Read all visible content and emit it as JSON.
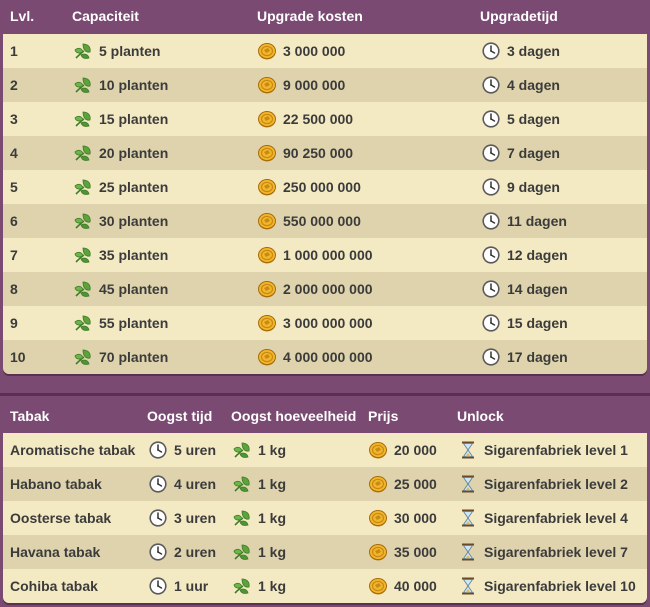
{
  "upgrade_table": {
    "headers": {
      "level": "Lvl.",
      "capacity": "Capaciteit",
      "cost": "Upgrade kosten",
      "time": "Upgradetijd"
    },
    "rows": [
      {
        "level": "1",
        "capacity": "5 planten",
        "cost": "3 000 000",
        "time": "3 dagen"
      },
      {
        "level": "2",
        "capacity": "10 planten",
        "cost": "9 000 000",
        "time": "4 dagen"
      },
      {
        "level": "3",
        "capacity": "15 planten",
        "cost": "22 500 000",
        "time": "5 dagen"
      },
      {
        "level": "4",
        "capacity": "20 planten",
        "cost": "90 250 000",
        "time": "7 dagen"
      },
      {
        "level": "5",
        "capacity": "25 planten",
        "cost": "250 000 000",
        "time": "9 dagen"
      },
      {
        "level": "6",
        "capacity": "30 planten",
        "cost": "550 000 000",
        "time": "11 dagen"
      },
      {
        "level": "7",
        "capacity": "35 planten",
        "cost": "1 000 000 000",
        "time": "12 dagen"
      },
      {
        "level": "8",
        "capacity": "45 planten",
        "cost": "2 000 000 000",
        "time": "14 dagen"
      },
      {
        "level": "9",
        "capacity": "55 planten",
        "cost": "3 000 000 000",
        "time": "15 dagen"
      },
      {
        "level": "10",
        "capacity": "70 planten",
        "cost": "4 000 000 000",
        "time": "17 dagen"
      }
    ]
  },
  "tobacco_table": {
    "headers": {
      "name": "Tabak",
      "harvest_time": "Oogst tijd",
      "harvest_amount": "Oogst hoeveelheid",
      "price": "Prijs",
      "unlock": "Unlock"
    },
    "rows": [
      {
        "name": "Aromatische tabak",
        "harvest_time": "5 uren",
        "harvest_amount": "1 kg",
        "price": "20 000",
        "unlock": "Sigarenfabriek level 1"
      },
      {
        "name": "Habano tabak",
        "harvest_time": "4 uren",
        "harvest_amount": "1 kg",
        "price": "25 000",
        "unlock": "Sigarenfabriek level 2"
      },
      {
        "name": "Oosterse tabak",
        "harvest_time": "3 uren",
        "harvest_amount": "1 kg",
        "price": "30 000",
        "unlock": "Sigarenfabriek level 4"
      },
      {
        "name": "Havana tabak",
        "harvest_time": "2 uren",
        "harvest_amount": "1 kg",
        "price": "35 000",
        "unlock": "Sigarenfabriek level 7"
      },
      {
        "name": "Cohiba tabak",
        "harvest_time": "1 uur",
        "harvest_amount": "1 kg",
        "price": "40 000",
        "unlock": "Sigarenfabriek level 10"
      }
    ]
  },
  "icons": {
    "capacity": "leaf-icon",
    "cost": "coin-icon",
    "time": "clock-icon",
    "unlock": "hourglass-icon"
  },
  "colors": {
    "header_bg": "#7b4a73",
    "row_light": "#f3e9c3",
    "row_dark": "#ded3ac",
    "header_text": "#ffffff"
  }
}
